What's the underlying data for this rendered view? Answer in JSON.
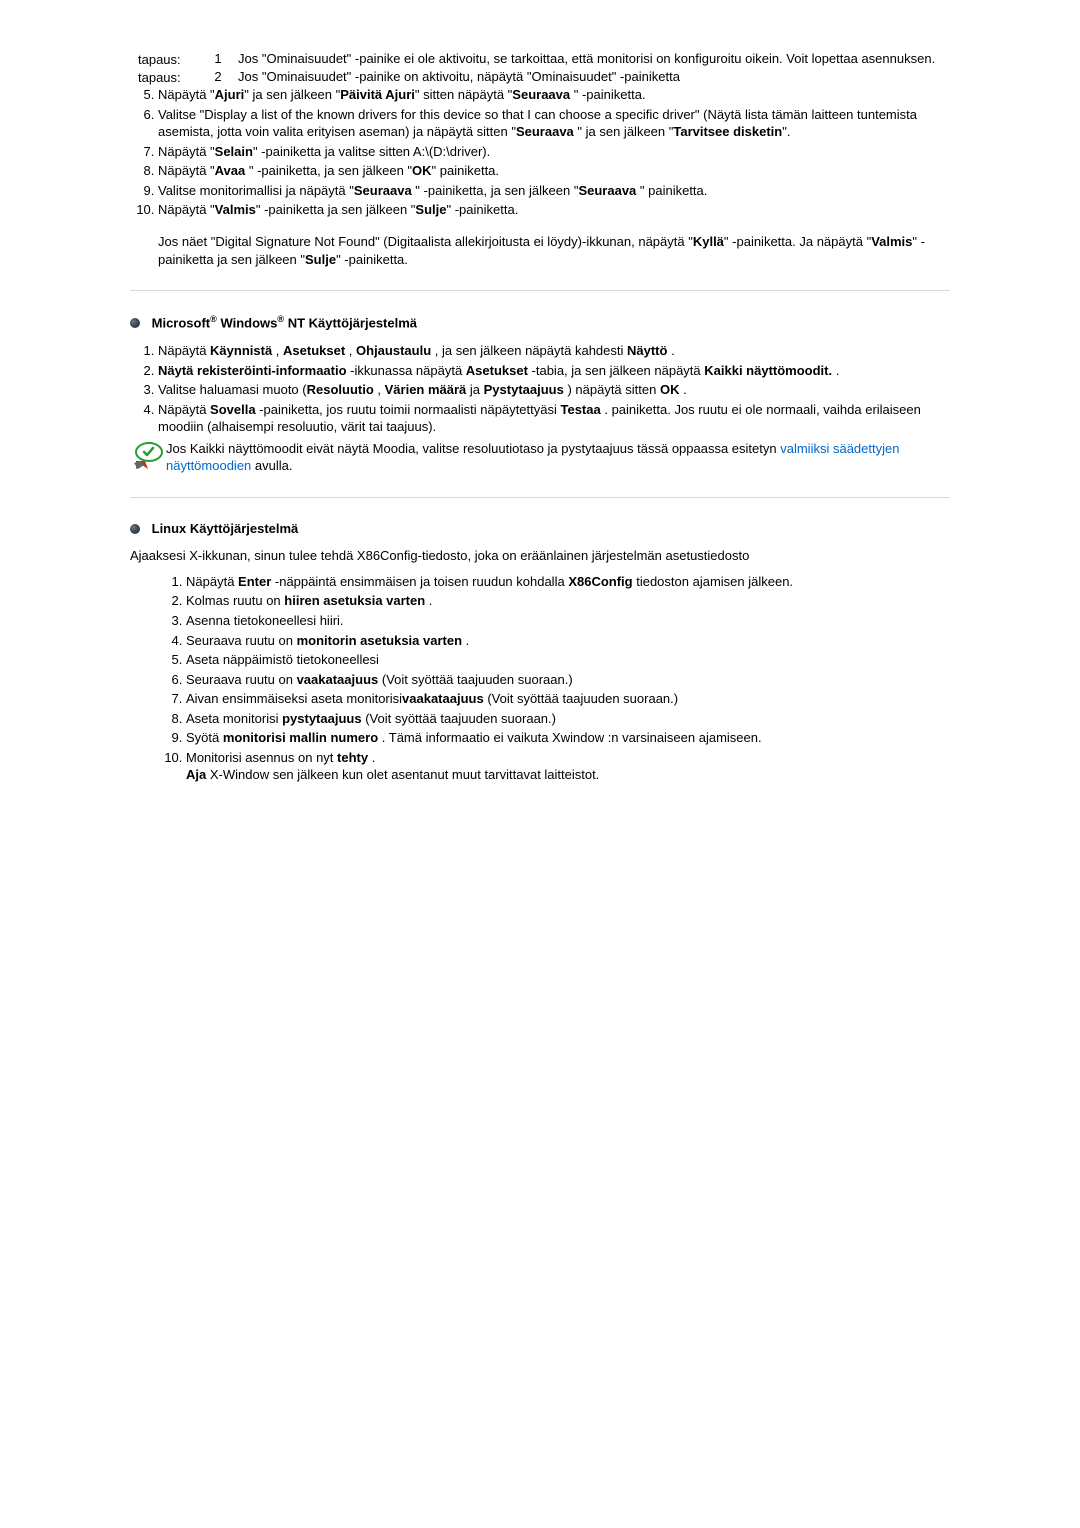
{
  "section_xp": {
    "case1_num": "1",
    "case1_label": "tapaus:",
    "case1_text": "Jos \"Ominaisuudet\" -painike ei ole aktivoitu, se tarkoittaa, että monitorisi on konfiguroitu oikein. Voit lopettaa asennuksen.",
    "case2_num": "2",
    "case2_label": "tapaus:",
    "case2_text": "Jos \"Ominaisuudet\" -painike on aktivoitu, näpäytä \"Ominaisuudet\" -painiketta",
    "li5_a": "Näpäytä \"",
    "li5_b": "Ajuri",
    "li5_c": "\" ja sen jälkeen \"",
    "li5_d": "Päivitä Ajuri",
    "li5_e": "\" sitten näpäytä \"",
    "li5_f": "Seuraava ",
    "li5_g": "\" -painiketta.",
    "li6_a": "Valitse \"Display a list of the known drivers for this device so that I can choose a specific driver\" (Näytä lista tämän laitteen tuntemista asemista, jotta voin valita erityisen aseman) ja näpäytä sitten \"",
    "li6_b": "Seuraava ",
    "li6_c": "\" ja sen jälkeen \"",
    "li6_d": "Tarvitsee disketin",
    "li6_e": "\".",
    "li7_a": "Näpäytä \"",
    "li7_b": "Selain",
    "li7_c": "\" -painiketta ja valitse sitten A:\\(D:\\driver).",
    "li8_a": "Näpäytä \"",
    "li8_b": "Avaa ",
    "li8_c": "\" -painiketta, ja sen jälkeen \"",
    "li8_d": "OK",
    "li8_e": "\" painiketta.",
    "li9_a": "Valitse monitorimallisi ja näpäytä \"",
    "li9_b": "Seuraava ",
    "li9_c": "\" -painiketta, ja sen jälkeen \"",
    "li9_d": "Seuraava ",
    "li9_e": "\" painiketta.",
    "li10_a": "Näpäytä \"",
    "li10_b": "Valmis",
    "li10_c": "\" -painiketta ja sen jälkeen \"",
    "li10_d": "Sulje",
    "li10_e": "\" -painiketta.",
    "post_a": "Jos näet \"Digital Signature Not Found\" (Digitaalista allekirjoitusta ei löydy)-ikkunan, näpäytä \"",
    "post_b": "Kyllä",
    "post_c": "\" -painiketta. Ja näpäytä \"",
    "post_d": "Valmis",
    "post_e": "\" -painiketta ja sen jälkeen \"",
    "post_f": "Sulje",
    "post_g": "\" -painiketta."
  },
  "section_nt": {
    "title_a": "Microsoft",
    "title_b": " Windows",
    "title_c": " NT Käyttöjärjestelmä",
    "reg": "®",
    "li1_a": "Näpäytä ",
    "li1_b": "Käynnistä",
    "li1_c": " , ",
    "li1_d": "Asetukset",
    "li1_e": " , ",
    "li1_f": "Ohjaustaulu",
    "li1_g": " , ja sen jälkeen näpäytä kahdesti ",
    "li1_h": "Näyttö",
    "li1_i": " .",
    "li2_a": "Näytä rekisteröinti-informaatio",
    "li2_b": " -ikkunassa näpäytä ",
    "li2_c": "Asetukset",
    "li2_d": " -tabia, ja sen jälkeen näpäytä ",
    "li2_e": "Kaikki näyttömoodit.",
    "li2_f": " .",
    "li3_a": "Valitse haluamasi muoto (",
    "li3_b": "Resoluutio",
    "li3_c": " , ",
    "li3_d": "Värien määrä",
    "li3_e": " ja ",
    "li3_f": "Pystytaajuus",
    "li3_g": " ) näpäytä sitten ",
    "li3_h": "OK",
    "li3_i": " .",
    "li4_a": "Näpäytä ",
    "li4_b": "Sovella",
    "li4_c": " -painiketta, jos ruutu toimii normaalisti näpäytettyäsi ",
    "li4_d": "Testaa",
    "li4_e": " . painiketta. Jos ruutu ei ole normaali, vaihda erilaiseen moodiin (alhaisempi resoluutio, värit tai taajuus).",
    "note_a": "Jos Kaikki näyttömoodit eivät näytä Moodia, valitse resoluutiotaso ja pystytaajuus tässä oppaassa esitetyn ",
    "note_link": "valmiiksi säädettyjen näyttömoodien",
    "note_b": " avulla."
  },
  "section_linux": {
    "title": "Linux Käyttöjärjestelmä",
    "intro": "Ajaaksesi X-ikkunan, sinun tulee tehdä X86Config-tiedosto, joka on eräänlainen järjestelmän asetustiedosto",
    "li1_a": "Näpäytä ",
    "li1_b": "Enter",
    "li1_c": " -näppäintä ensimmäisen ja toisen ruudun kohdalla ",
    "li1_d": "X86Config",
    "li1_e": " tiedoston ajamisen jälkeen.",
    "li2_a": "Kolmas ruutu on ",
    "li2_b": "hiiren asetuksia varten",
    "li2_c": " .",
    "li3": "Asenna tietokoneellesi hiiri.",
    "li4_a": "Seuraava ruutu on ",
    "li4_b": "monitorin asetuksia varten",
    "li4_c": " .",
    "li5": "Aseta näppäimistö tietokoneellesi",
    "li6_a": "Seuraava ruutu on ",
    "li6_b": "vaakataajuus",
    "li6_c": " (Voit syöttää taajuuden suoraan.)",
    "li7_a": "Aivan ensimmäiseksi aseta monitorisi",
    "li7_b": "vaakataajuus",
    "li7_c": " (Voit syöttää taajuuden suoraan.)",
    "li8_a": "Aseta monitorisi ",
    "li8_b": "pystytaajuus",
    "li8_c": " (Voit syöttää taajuuden suoraan.)",
    "li9_a": "Syötä ",
    "li9_b": "monitorisi mallin numero",
    "li9_c": " . Tämä informaatio ei vaikuta Xwindow :n varsinaiseen ajamiseen.",
    "li10_a": "Monitorisi asennus on nyt ",
    "li10_b": "tehty",
    "li10_c": " .",
    "li10_sub_a": "Aja",
    "li10_sub_b": " X-Window sen jälkeen kun olet asentanut muut tarvittavat laitteistot."
  }
}
